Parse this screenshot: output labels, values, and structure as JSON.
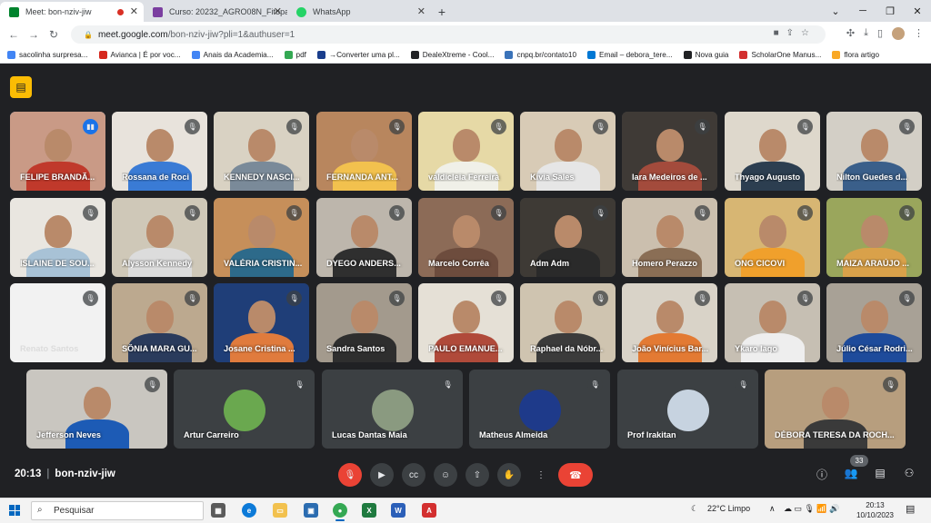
{
  "tabs": [
    {
      "title": "Meet: bon-nziv-jiw",
      "color": "#00832d"
    },
    {
      "title": "Curso: 20232_AGRO08N_Fitopat",
      "color": "#7b3fa0"
    },
    {
      "title": "WhatsApp",
      "color": "#25d366"
    }
  ],
  "browser": {
    "url_host": "meet.google.com",
    "url_path": "/bon-nziv-jiw?pli=1&authuser=1",
    "new_tab": "+",
    "bookmarks": [
      {
        "label": "sacolinha surpresa...",
        "color": "#4285f4"
      },
      {
        "label": "Avianca | É por voc...",
        "color": "#d6281e"
      },
      {
        "label": "Anais da Academia...",
        "color": "#4285f4"
      },
      {
        "label": "pdf",
        "color": "#34a853"
      },
      {
        "label": "→Converter uma pl...",
        "color": "#1a3e8c"
      },
      {
        "label": "DealeXtreme - Cool...",
        "color": "#202124"
      },
      {
        "label": "cnpq.br/contato10",
        "color": "#3b73b9"
      },
      {
        "label": "Email – debora_tere...",
        "color": "#0078d4"
      },
      {
        "label": "Nova guia",
        "color": "#202124"
      },
      {
        "label": "ScholarOne Manus...",
        "color": "#d32f2f"
      },
      {
        "label": "flora artigo",
        "color": "#f9a825"
      }
    ]
  },
  "meet": {
    "participants": [
      {
        "name": "FELIPE BRANDÃ...",
        "bg": "#c99a86",
        "shirt": "#c0392b",
        "speaking": true
      },
      {
        "name": "Rossana de Roci",
        "bg": "#e8e3dc",
        "shirt": "#3a7bd5"
      },
      {
        "name": "KENNEDY NASCI...",
        "bg": "#d9d2c3",
        "shirt": "#7a8a99"
      },
      {
        "name": "FERNANDA ANT...",
        "bg": "#b8865e",
        "shirt": "#f2c14e"
      },
      {
        "name": "valdicleia Ferreira",
        "bg": "#e6d9a6",
        "shirt": "#f0f0e8"
      },
      {
        "name": "Kivia Sales",
        "bg": "#d8cbb6",
        "shirt": "#e6e6e6"
      },
      {
        "name": "Iara Medeiros de ...",
        "bg": "#3f3a36",
        "shirt": "#a34b3c"
      },
      {
        "name": "Thyago Augusto",
        "bg": "#ded8cc",
        "shirt": "#2c3e50"
      },
      {
        "name": "Nilton Guedes d...",
        "bg": "#d3cfc6",
        "shirt": "#3a5f8a"
      },
      {
        "name": "ISLAINE DE SOU...",
        "bg": "#e9e6e0",
        "shirt": "#a8c2d6"
      },
      {
        "name": "Alysson Kennedy",
        "bg": "#cfc8b8",
        "shirt": "#dcdcdc"
      },
      {
        "name": "VALÉRIA CRISTIN...",
        "bg": "#c68f5a",
        "shirt": "#2d6a8a"
      },
      {
        "name": "DYEGO ANDERS...",
        "bg": "#bdb6ac",
        "shirt": "#2f2f2f"
      },
      {
        "name": "Marcelo Corrêa",
        "bg": "#8c6b57",
        "shirt": "#6d4c3d"
      },
      {
        "name": "Adm Adm",
        "bg": "#3e3a35",
        "shirt": "#2a2a2a"
      },
      {
        "name": "Homero Perazzo",
        "bg": "#cbbfae",
        "shirt": "#8a6e55"
      },
      {
        "name": "ONG CICOVI",
        "bg": "#d7b673",
        "shirt": "#f0a02c"
      },
      {
        "name": "MAIZA ARAÚJO ...",
        "bg": "#9aa65c",
        "shirt": "#d9a14a"
      },
      {
        "name": "Renato Santos",
        "bg": "#f2f2f2",
        "shirt": "#f2f2f2"
      },
      {
        "name": "SÔNIA MARA GU...",
        "bg": "#bca98f",
        "shirt": "#2a3b5c"
      },
      {
        "name": "Josane Cristina ...",
        "bg": "#1f3e78",
        "shirt": "#e07b3d"
      },
      {
        "name": "Sandra Santos",
        "bg": "#a39a8d",
        "shirt": "#2e2e2e"
      },
      {
        "name": "PAULO EMANUE...",
        "bg": "#e5e0d6",
        "shirt": "#b04a3a"
      },
      {
        "name": "Raphael da Nóbr...",
        "bg": "#cfc4b0",
        "shirt": "#3b3b3b"
      },
      {
        "name": "João Vinícius Bar...",
        "bg": "#d9d3c8",
        "shirt": "#e37a33"
      },
      {
        "name": "Ykaro Iago",
        "bg": "#c6bfb3",
        "shirt": "#eeeeee"
      },
      {
        "name": "Júlio César Rodri...",
        "bg": "#a8a196",
        "shirt": "#1e4b9b"
      },
      {
        "name": "Jefferson Neves",
        "bg": "#c9c6c0",
        "shirt": "#1d5bb5"
      },
      {
        "name": "Artur Carreiro",
        "avatar": "#6aa84f"
      },
      {
        "name": "Lucas Dantas Maia",
        "avatar": "#8a9a80"
      },
      {
        "name": "Matheus Almeida",
        "avatar": "#1e3a8a"
      },
      {
        "name": "Prof Irakitan",
        "avatar": "#c7d3e0"
      },
      {
        "name": "DÉBORA TERESA DA ROCH...",
        "bg": "#b79e7e",
        "shirt": "#3a3a3a"
      }
    ],
    "meeting_time": "20:13",
    "meeting_code": "bon-nziv-jiw",
    "participant_count": "33"
  },
  "taskbar": {
    "search_placeholder": "Pesquisar",
    "weather": "22°C  Limpo",
    "time": "20:13",
    "date": "10/10/2023"
  }
}
